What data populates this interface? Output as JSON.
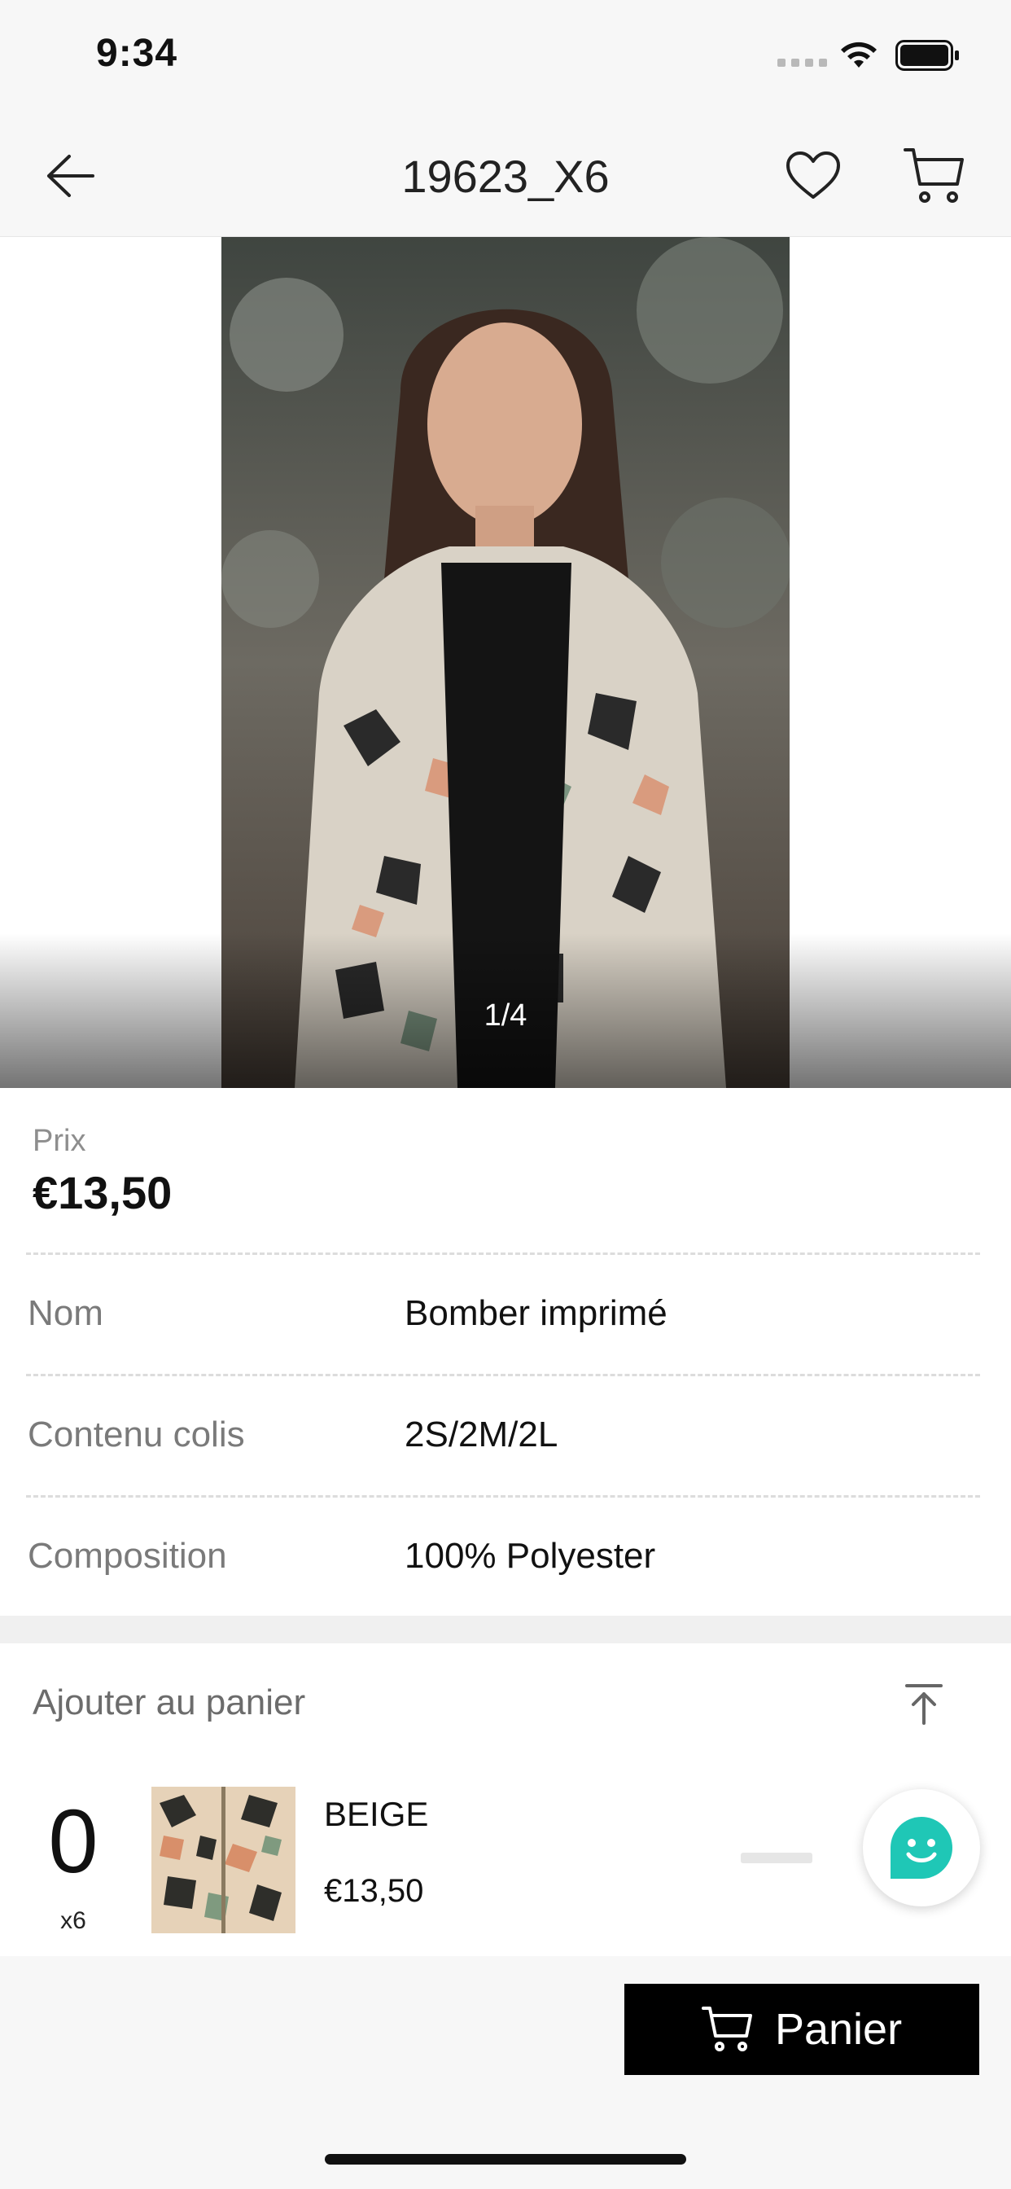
{
  "status_bar": {
    "time": "9:34"
  },
  "nav": {
    "title": "19623_X6"
  },
  "gallery": {
    "counter": "1/4"
  },
  "product": {
    "price_label": "Prix",
    "price": "€13,50",
    "rows": [
      {
        "label": "Nom",
        "value": "Bomber imprimé"
      },
      {
        "label": "Contenu colis",
        "value": "2S/2M/2L"
      },
      {
        "label": "Composition",
        "value": "100% Polyester"
      }
    ]
  },
  "cart": {
    "header": "Ajouter au panier",
    "variant": {
      "quantity": "0",
      "pack": "x6",
      "color": "BEIGE",
      "price": "€13,50"
    },
    "button_label": "Panier"
  },
  "icons": {
    "back": "arrow-left-icon",
    "favorite": "heart-icon",
    "cart": "cart-icon",
    "scroll_top": "arrow-up-to-line-icon",
    "chat": "smiley-chat-icon"
  },
  "colors": {
    "chat_accent": "#1fc7b6",
    "button_bg": "#000000"
  }
}
